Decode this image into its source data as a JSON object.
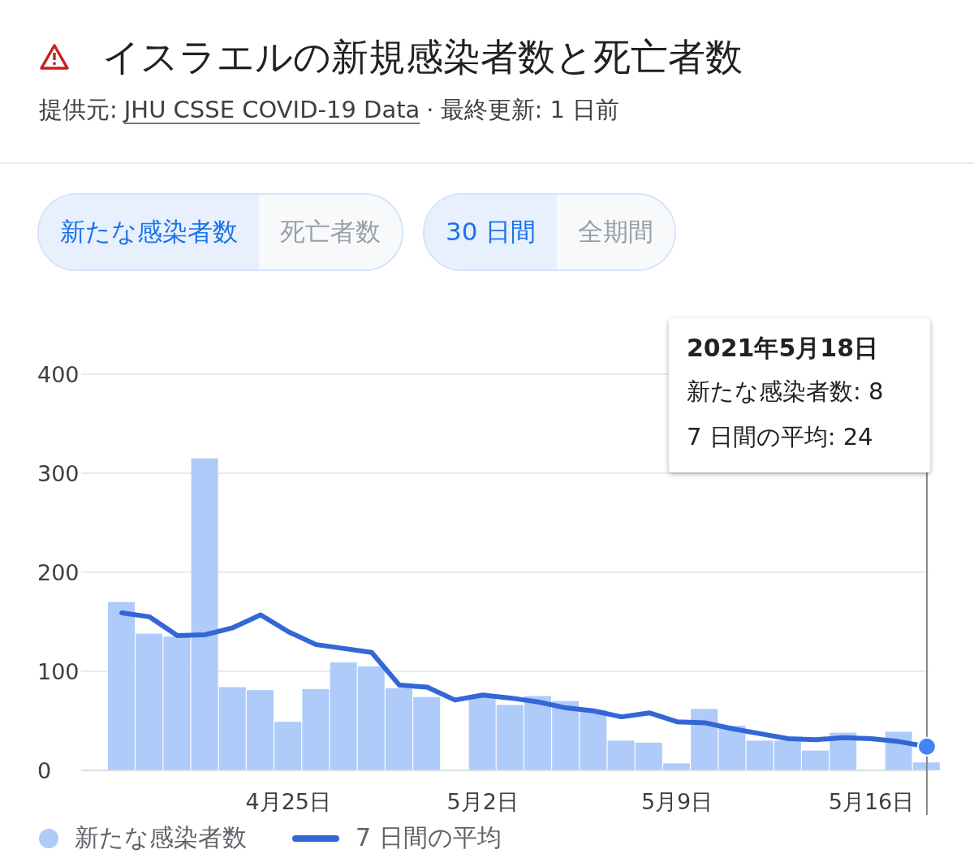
{
  "header": {
    "title": "イスラエルの新規感染者数と死亡者数",
    "source_label": "提供元:",
    "source_link": "JHU CSSE COVID-19 Data",
    "separator": "·",
    "updated": "最終更新: 1 日前"
  },
  "toggle_groups": [
    {
      "options": [
        {
          "label": "新たな感染者数",
          "selected": true
        },
        {
          "label": "死亡者数",
          "selected": false
        }
      ]
    },
    {
      "options": [
        {
          "label": "30 日間",
          "selected": true
        },
        {
          "label": "全期間",
          "selected": false
        }
      ]
    }
  ],
  "tooltip": {
    "date": "2021年5月18日",
    "lines": [
      "新たな感染者数: 8",
      "7 日間の平均: 24"
    ]
  },
  "chart_data": {
    "type": "bar",
    "grid": true,
    "ylim": [
      0,
      400
    ],
    "yticks": [
      0,
      100,
      200,
      300,
      400
    ],
    "categories": [
      null,
      null,
      null,
      null,
      null,
      null,
      "4月25日",
      null,
      null,
      null,
      null,
      null,
      null,
      "5月2日",
      null,
      null,
      null,
      null,
      null,
      null,
      "5月9日",
      null,
      null,
      null,
      null,
      null,
      null,
      "5月16日",
      null,
      null
    ],
    "series": [
      {
        "name": "新たな感染者数",
        "color": "#aecbfa",
        "type": "bar",
        "values": [
          170,
          138,
          135,
          315,
          84,
          81,
          49,
          82,
          109,
          105,
          83,
          74,
          0,
          74,
          66,
          75,
          70,
          61,
          30,
          28,
          7,
          62,
          45,
          30,
          30,
          20,
          38,
          0,
          39,
          8
        ]
      },
      {
        "name": "7 日間の平均",
        "color": "#3367d6",
        "type": "line",
        "values": [
          159,
          155,
          136,
          137,
          144,
          157,
          140,
          127,
          123,
          119,
          86,
          84,
          71,
          76,
          73,
          69,
          63,
          60,
          54,
          58,
          49,
          48,
          42,
          37,
          32,
          31,
          33,
          32,
          29,
          24
        ]
      }
    ]
  }
}
